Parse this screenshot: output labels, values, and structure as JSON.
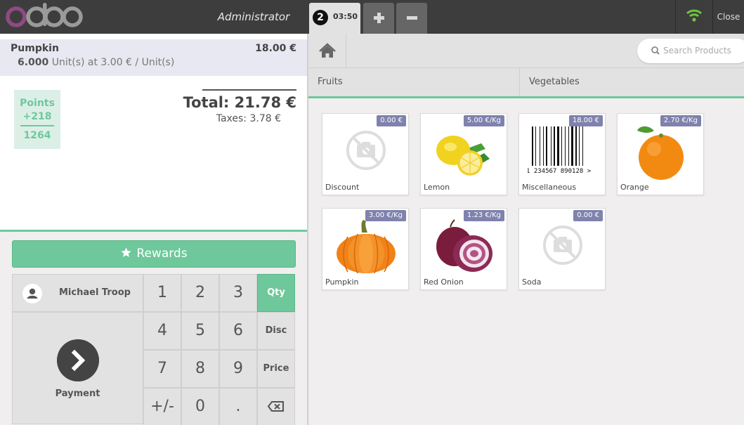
{
  "topbar": {
    "logo_text": "odoo",
    "user": "Administrator",
    "order_number": "2",
    "order_time": "03:50",
    "close_label": "Close",
    "wifi_color": "#6ec43e"
  },
  "orderline": {
    "product": "Pumpkin",
    "price": "18.00 €",
    "qty": "6.000",
    "unit_info": " Unit(s) at 3.00 € / Unit(s)"
  },
  "points": {
    "label": "Points",
    "won": "+218",
    "total": "1264"
  },
  "totals": {
    "total": "Total: 21.78 €",
    "taxes": "Taxes: 3.78 €"
  },
  "controls": {
    "rewards_label": "Rewards",
    "customer": "Michael Troop",
    "payment_label": "Payment",
    "keys": [
      "1",
      "2",
      "3",
      "Qty",
      "4",
      "5",
      "6",
      "Disc",
      "7",
      "8",
      "9",
      "Price",
      "+/-",
      "0",
      "."
    ],
    "active_mode": "Qty"
  },
  "search": {
    "placeholder": "Search Products"
  },
  "categories": [
    "Fruits",
    "Vegetables"
  ],
  "products": [
    {
      "name": "Discount",
      "price": "0.00 €",
      "icon": "no-image-icon"
    },
    {
      "name": "Lemon",
      "price": "5.00 €/Kg",
      "icon": "lemon-icon"
    },
    {
      "name": "Miscellaneous",
      "price": "18.00 €",
      "icon": "barcode-icon"
    },
    {
      "name": "Orange",
      "price": "2.70 €/Kg",
      "icon": "orange-icon"
    },
    {
      "name": "Pumpkin",
      "price": "3.00 €/Kg",
      "icon": "pumpkin-icon"
    },
    {
      "name": "Red Onion",
      "price": "1.23 €/Kg",
      "icon": "red-onion-icon"
    },
    {
      "name": "Soda",
      "price": "0.00 €",
      "icon": "no-image-icon"
    }
  ],
  "barcode_digits": "1 234567 890128 >",
  "colors": {
    "accent": "#6ec89b",
    "topbar": "#3d3d3d",
    "logo_purple": "#8f4a84",
    "price_tag": "#7f82ac"
  }
}
